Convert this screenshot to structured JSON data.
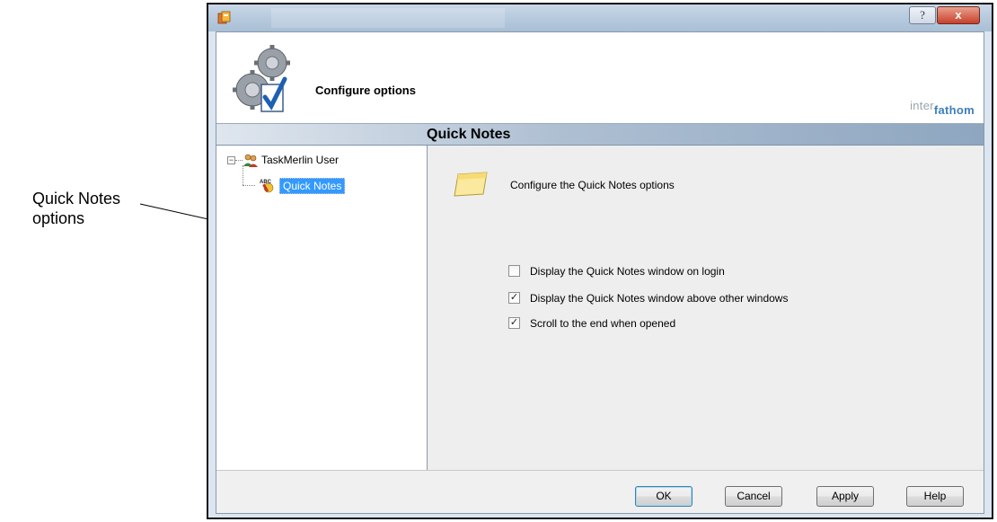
{
  "annotation": {
    "line1": "Quick Notes",
    "line2": "options"
  },
  "titlebar": {
    "help_label": "?",
    "close_label": "x"
  },
  "header": {
    "title": "Configure options",
    "brand_part1": "inter",
    "brand_part2": "fathom"
  },
  "section": {
    "title": "Quick Notes"
  },
  "tree": {
    "root": {
      "label": "TaskMerlin User",
      "expander": "−"
    },
    "child": {
      "label": "Quick Notes"
    }
  },
  "panel": {
    "description": "Configure the Quick Notes options",
    "options": [
      {
        "label": "Display the Quick Notes window on login",
        "checked": false,
        "mark": ""
      },
      {
        "label": "Display the Quick Notes window above other windows",
        "checked": true,
        "mark": "✓"
      },
      {
        "label": "Scroll to the end when opened",
        "checked": true,
        "mark": "✓"
      }
    ]
  },
  "buttons": {
    "ok": "OK",
    "cancel": "Cancel",
    "apply": "Apply",
    "help": "Help"
  },
  "colors": {
    "selection": "#3399ff",
    "section_bar": "#aebfd2",
    "close_button": "#c7402a"
  }
}
